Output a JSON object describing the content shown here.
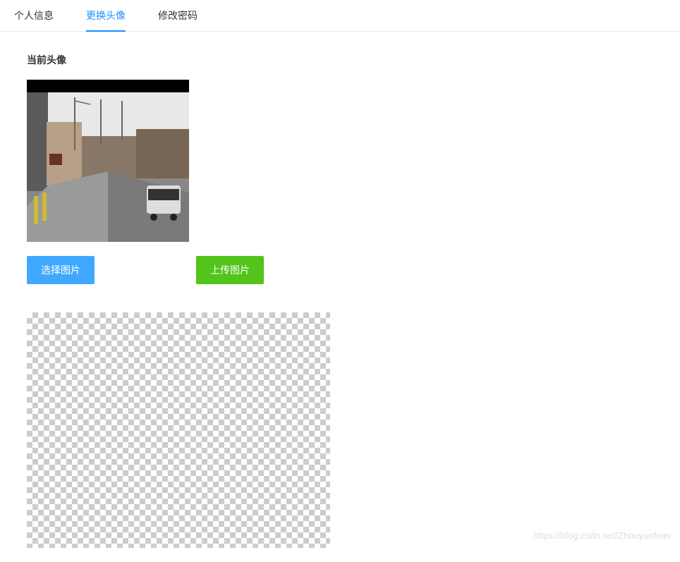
{
  "tabs": {
    "personal_info": "个人信息",
    "change_avatar": "更换头像",
    "change_password": "修改密码"
  },
  "section": {
    "current_avatar_label": "当前头像"
  },
  "buttons": {
    "select_image": "选择图片",
    "upload_image": "上传图片"
  },
  "watermark": "https://blog.csdn.net/Zhouyunfeier"
}
